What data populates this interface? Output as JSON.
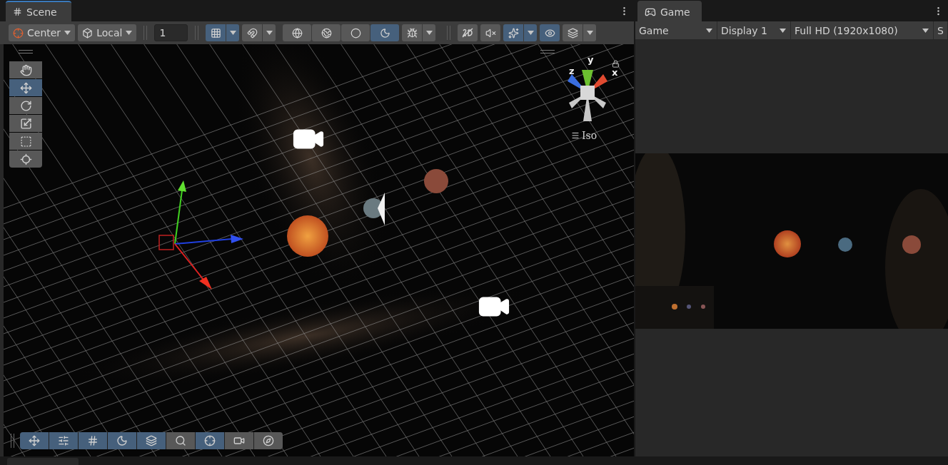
{
  "scene_tab": {
    "label": "Scene",
    "selected": true
  },
  "game_tab": {
    "label": "Game",
    "selected": true
  },
  "scene_toolbar": [
    {
      "items": [
        {
          "kind": "dropdown",
          "label": "Center"
        },
        {
          "kind": "dropdown",
          "label": "Local"
        }
      ]
    },
    {
      "items": [
        {
          "kind": "input",
          "value": "1"
        }
      ]
    },
    {
      "items": [
        {
          "kind": "toggle",
          "selected": true,
          "dropdown": true
        },
        {
          "kind": "toggle",
          "selected": false,
          "dropdown": true
        }
      ]
    },
    {
      "items": [
        {
          "kind": "toggle",
          "selected": false,
          "dropdown": false
        },
        {
          "kind": "toggle",
          "selected": false,
          "dropdown": false
        },
        {
          "kind": "toggle",
          "selected": false,
          "dropdown": false
        },
        {
          "kind": "toggle",
          "selected": true,
          "dropdown": false
        }
      ]
    },
    {
      "items": [
        {
          "kind": "toggle",
          "selected": false,
          "dropdown": true
        }
      ]
    },
    {
      "items": [
        {
          "kind": "toggle",
          "selected": false,
          "dropdown": false
        }
      ]
    },
    {
      "items": [
        {
          "kind": "toggle",
          "selected": false,
          "dropdown": false
        }
      ]
    },
    {
      "items": [
        {
          "kind": "toggle",
          "selected": true,
          "dropdown": true
        }
      ]
    },
    {
      "items": [
        {
          "kind": "toggle",
          "selected": true,
          "dropdown": false
        }
      ]
    },
    {
      "items": [
        {
          "kind": "toggle",
          "selected": false,
          "dropdown": true
        }
      ]
    }
  ],
  "tools": [
    {
      "selected": false
    },
    {
      "selected": true
    },
    {
      "selected": false
    },
    {
      "selected": false
    },
    {
      "selected": false
    },
    {
      "selected": false
    }
  ],
  "orientation_gizmo": {
    "axes": [
      "y",
      "z",
      "x"
    ],
    "view_mode": "Iso"
  },
  "overlay_toolbar": [
    {
      "selected": true
    },
    {
      "selected": true
    },
    {
      "selected": true
    },
    {
      "selected": true
    },
    {
      "selected": true
    },
    {
      "selected": false
    },
    {
      "selected": true
    },
    {
      "selected": false
    },
    {
      "selected": false
    }
  ],
  "game_toolbar": [
    {
      "label": "Game"
    },
    {
      "label": "Display 1"
    },
    {
      "label": "Full HD (1920x1080)"
    },
    {
      "label": "S"
    }
  ]
}
